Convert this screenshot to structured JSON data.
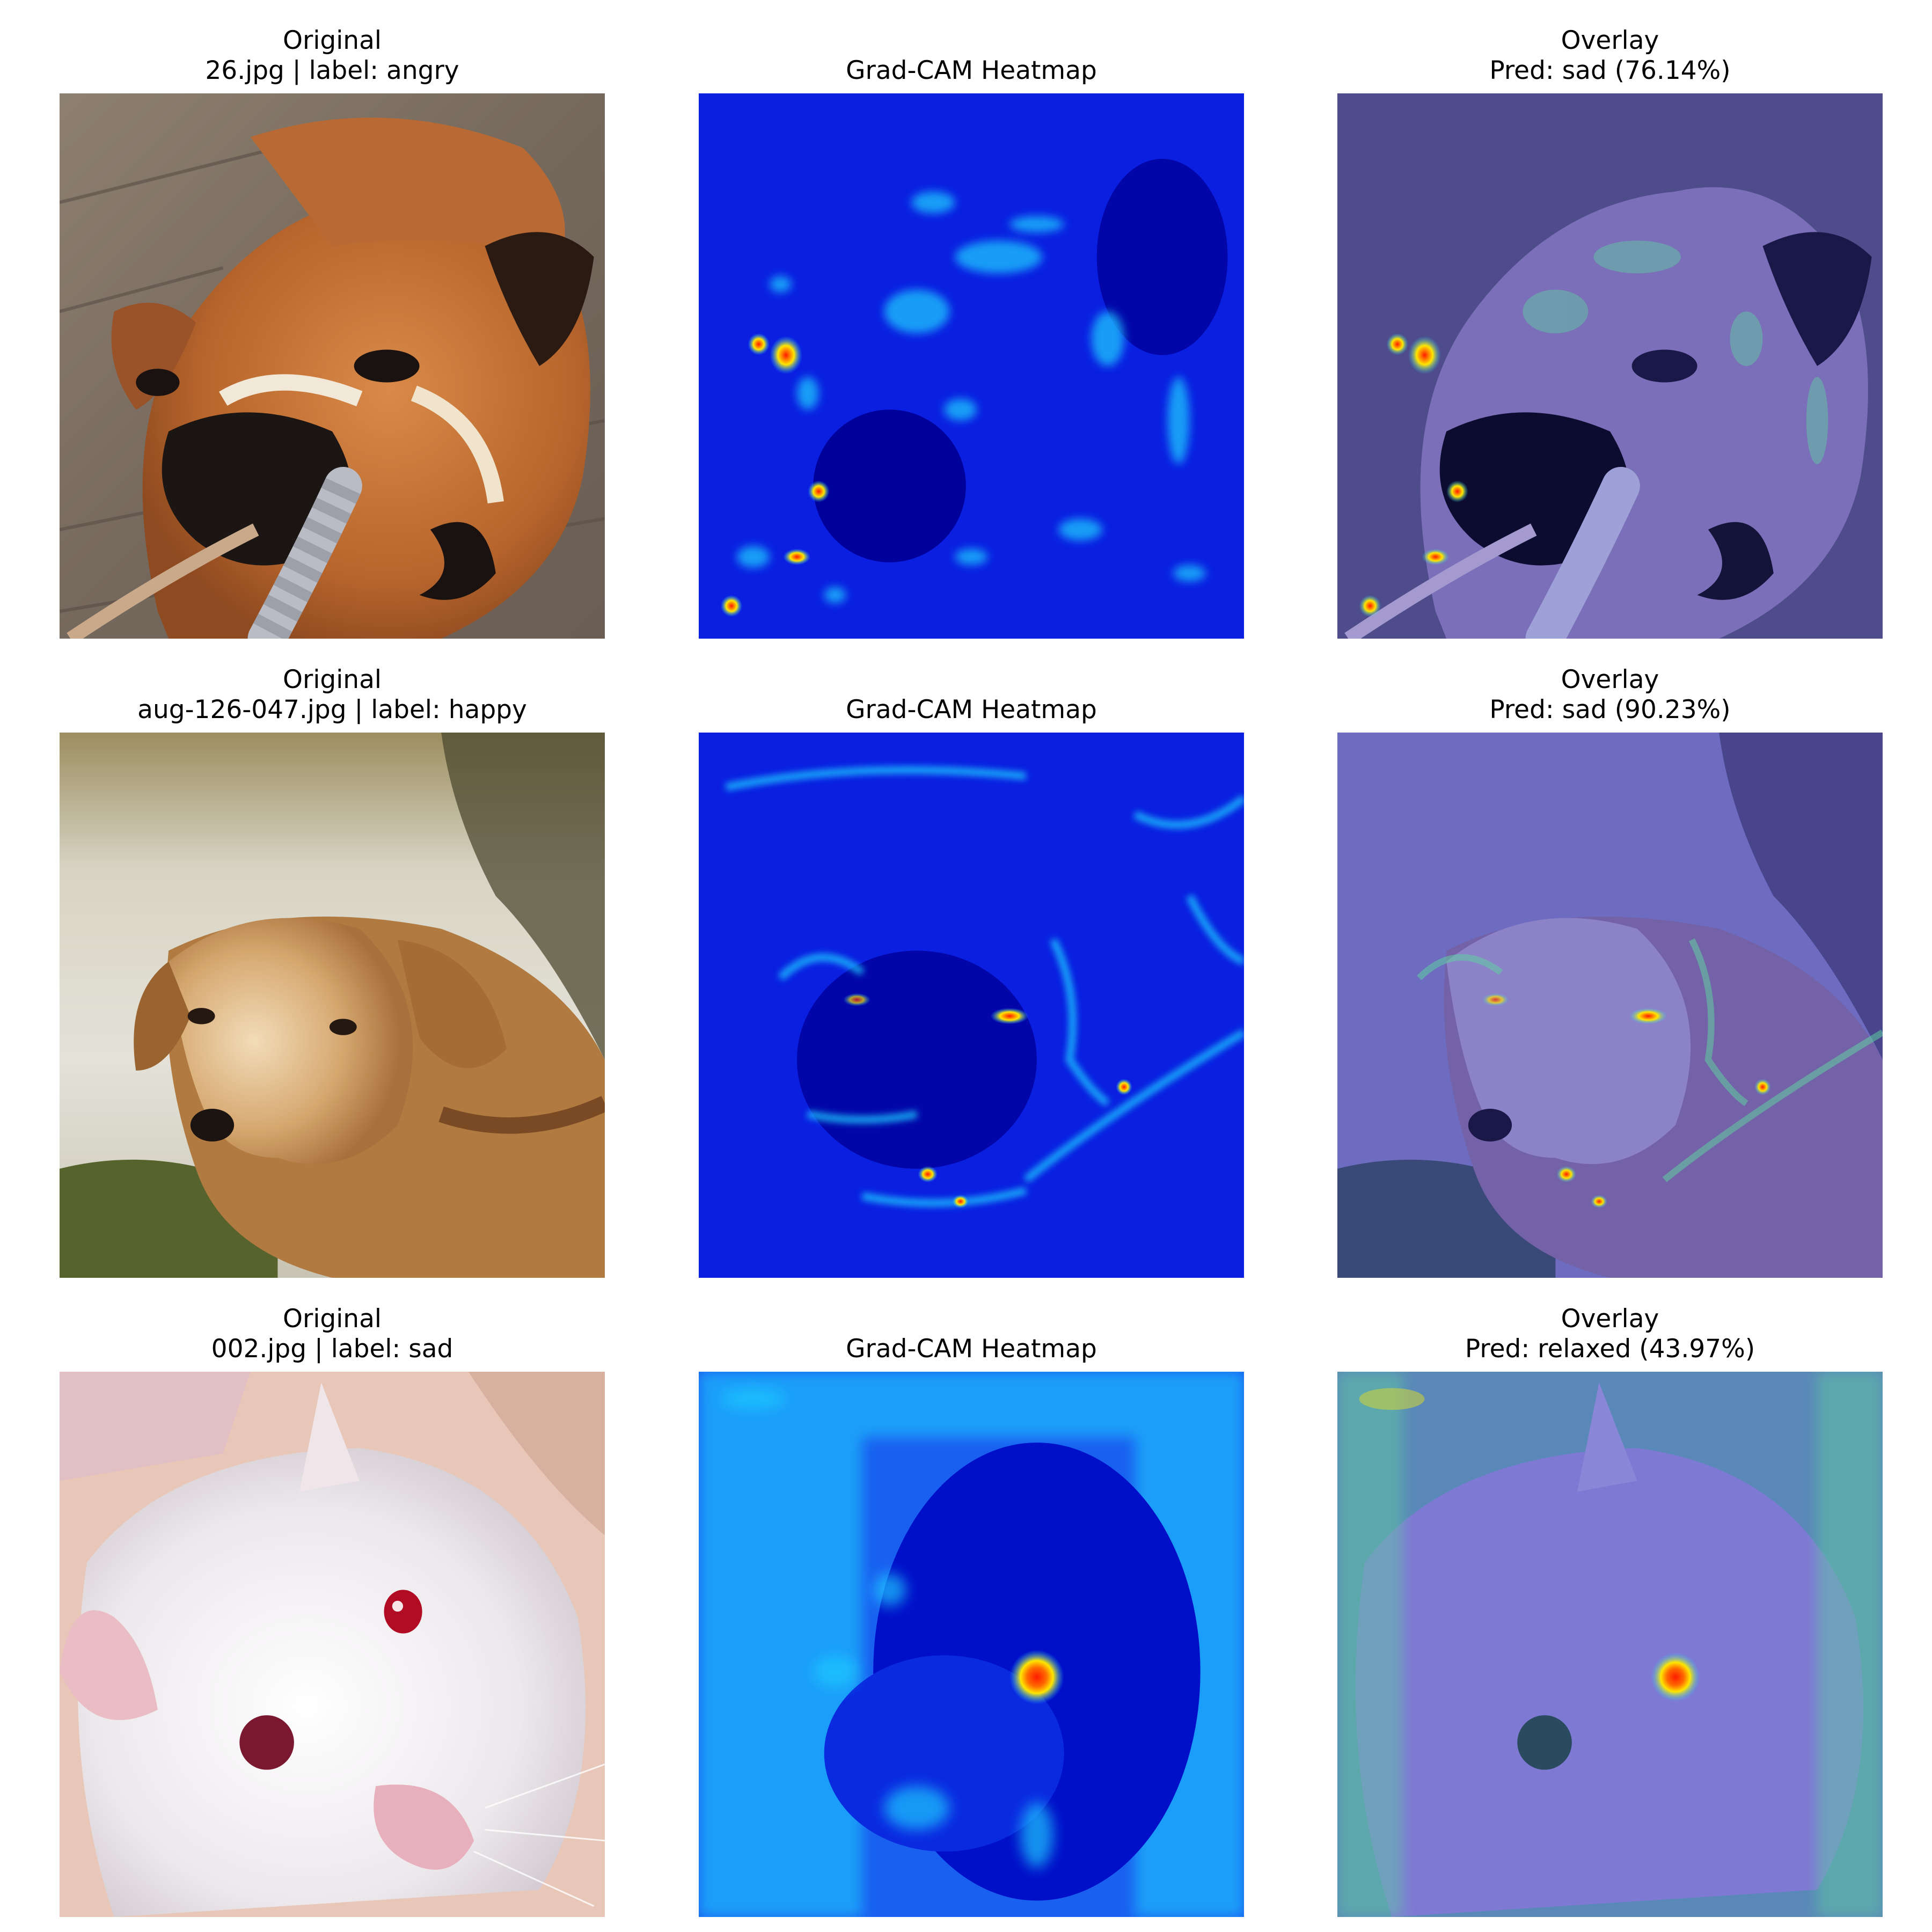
{
  "figure": {
    "rows": [
      {
        "original": {
          "title": "Original",
          "subtitle": "26.jpg | label: angry"
        },
        "heatmap": {
          "title": "Grad-CAM Heatmap"
        },
        "overlay": {
          "title": "Overlay",
          "subtitle": "Pred: sad (76.14%)"
        }
      },
      {
        "original": {
          "title": "Original",
          "subtitle": "aug-126-047.jpg | label: happy"
        },
        "heatmap": {
          "title": "Grad-CAM Heatmap"
        },
        "overlay": {
          "title": "Overlay",
          "subtitle": "Pred: sad (90.23%)"
        }
      },
      {
        "original": {
          "title": "Original",
          "subtitle": "002.jpg | label: sad"
        },
        "heatmap": {
          "title": "Grad-CAM Heatmap"
        },
        "overlay": {
          "title": "Overlay",
          "subtitle": "Pred: relaxed (43.97%)"
        }
      }
    ]
  },
  "colors": {
    "heatmap_base": "#0a1fe0",
    "heatmap_dark": "#00009a",
    "heatmap_cyan": "#1ec8ff",
    "heatmap_hot": "#ff2a00",
    "overlay_tint": "#6a6ad8"
  }
}
